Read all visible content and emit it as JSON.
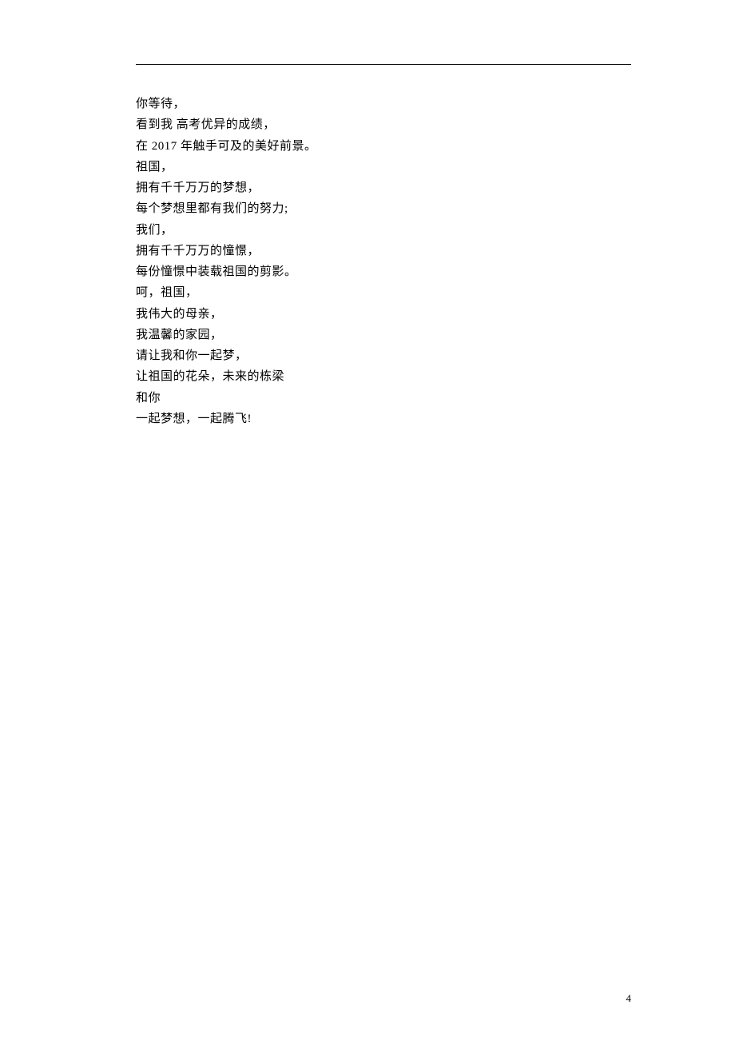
{
  "poem": {
    "lines": [
      "你等待，",
      "看到我 高考优异的成绩，",
      "在 2017 年触手可及的美好前景。",
      "祖国，",
      "拥有千千万万的梦想，",
      "每个梦想里都有我们的努力;",
      "我们，",
      "拥有千千万万的憧憬，",
      "每份憧憬中装载祖国的剪影。",
      "呵，祖国，",
      "我伟大的母亲，",
      "我温馨的家园，",
      "请让我和你一起梦，",
      "让祖国的花朵，未来的栋梁",
      "和你",
      "一起梦想，一起腾飞!"
    ]
  },
  "page_number": "4"
}
